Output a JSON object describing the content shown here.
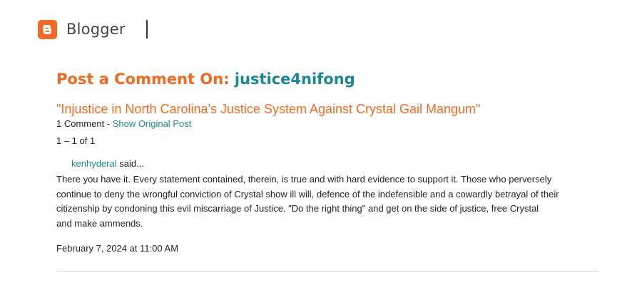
{
  "header": {
    "brand": "Blogger",
    "logo_icon": "blogger-logo-icon",
    "accent_color": "#f26a21"
  },
  "page": {
    "heading_prefix": "Post a Comment On:",
    "blog_name": "justice4nifong",
    "post_title": "\"Injustice in North Carolina's Justice System Against Crystal Gail Mangum\"",
    "comment_count": "1 Comment",
    "meta_separator": " - ",
    "show_original": "Show Original Post",
    "range": "1 – 1 of 1"
  },
  "comment": {
    "author": "kenhyderal",
    "said": "said...",
    "body_lines": [
      "There you have it. Every statement contained, therein, is true and with hard evidence to support it. Those who perversely",
      "continue to deny the wrongful conviction of Crystal show ill will, defence of the indefensible  and a cowardly betrayal of their",
      "citizenship by condoning this evil miscarriage of Justice. \"Do the right thing\" and get on the side of justice, free Crystal",
      "and make ammends."
    ],
    "timestamp": "February 7, 2024 at 11:00 AM"
  }
}
